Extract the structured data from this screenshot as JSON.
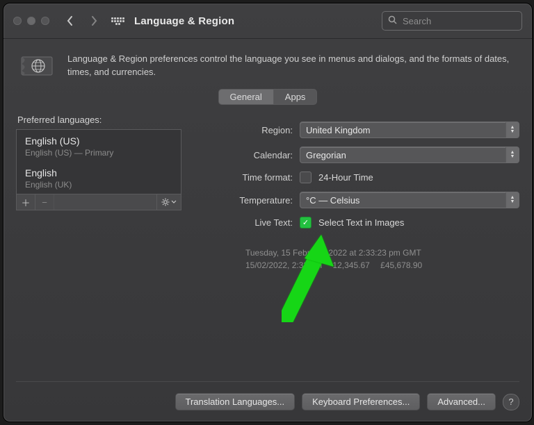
{
  "title": "Language & Region",
  "search": {
    "placeholder": "Search"
  },
  "intro": "Language & Region preferences control the language you see in menus and dialogs, and the formats of dates, times, and currencies.",
  "tabs": {
    "general": "General",
    "apps": "Apps"
  },
  "left": {
    "label": "Preferred languages:",
    "items": [
      {
        "name": "English (US)",
        "sub": "English (US) — Primary"
      },
      {
        "name": "English",
        "sub": "English (UK)"
      }
    ]
  },
  "form": {
    "region_label": "Region:",
    "region_value": "United Kingdom",
    "calendar_label": "Calendar:",
    "calendar_value": "Gregorian",
    "timeformat_label": "Time format:",
    "timeformat_option": "24-Hour Time",
    "timeformat_checked": false,
    "temperature_label": "Temperature:",
    "temperature_value": "°C — Celsius",
    "livetext_label": "Live Text:",
    "livetext_option": "Select Text in Images",
    "livetext_checked": true,
    "sample_line1": "Tuesday, 15 February 2022 at 2:33:23 pm GMT",
    "sample_line2": "15/02/2022, 2:33 pm  12,345.67  £45,678.90"
  },
  "buttons": {
    "translation": "Translation Languages...",
    "keyboard": "Keyboard Preferences...",
    "advanced": "Advanced...",
    "help": "?"
  },
  "colors": {
    "accent": "#23c040"
  }
}
